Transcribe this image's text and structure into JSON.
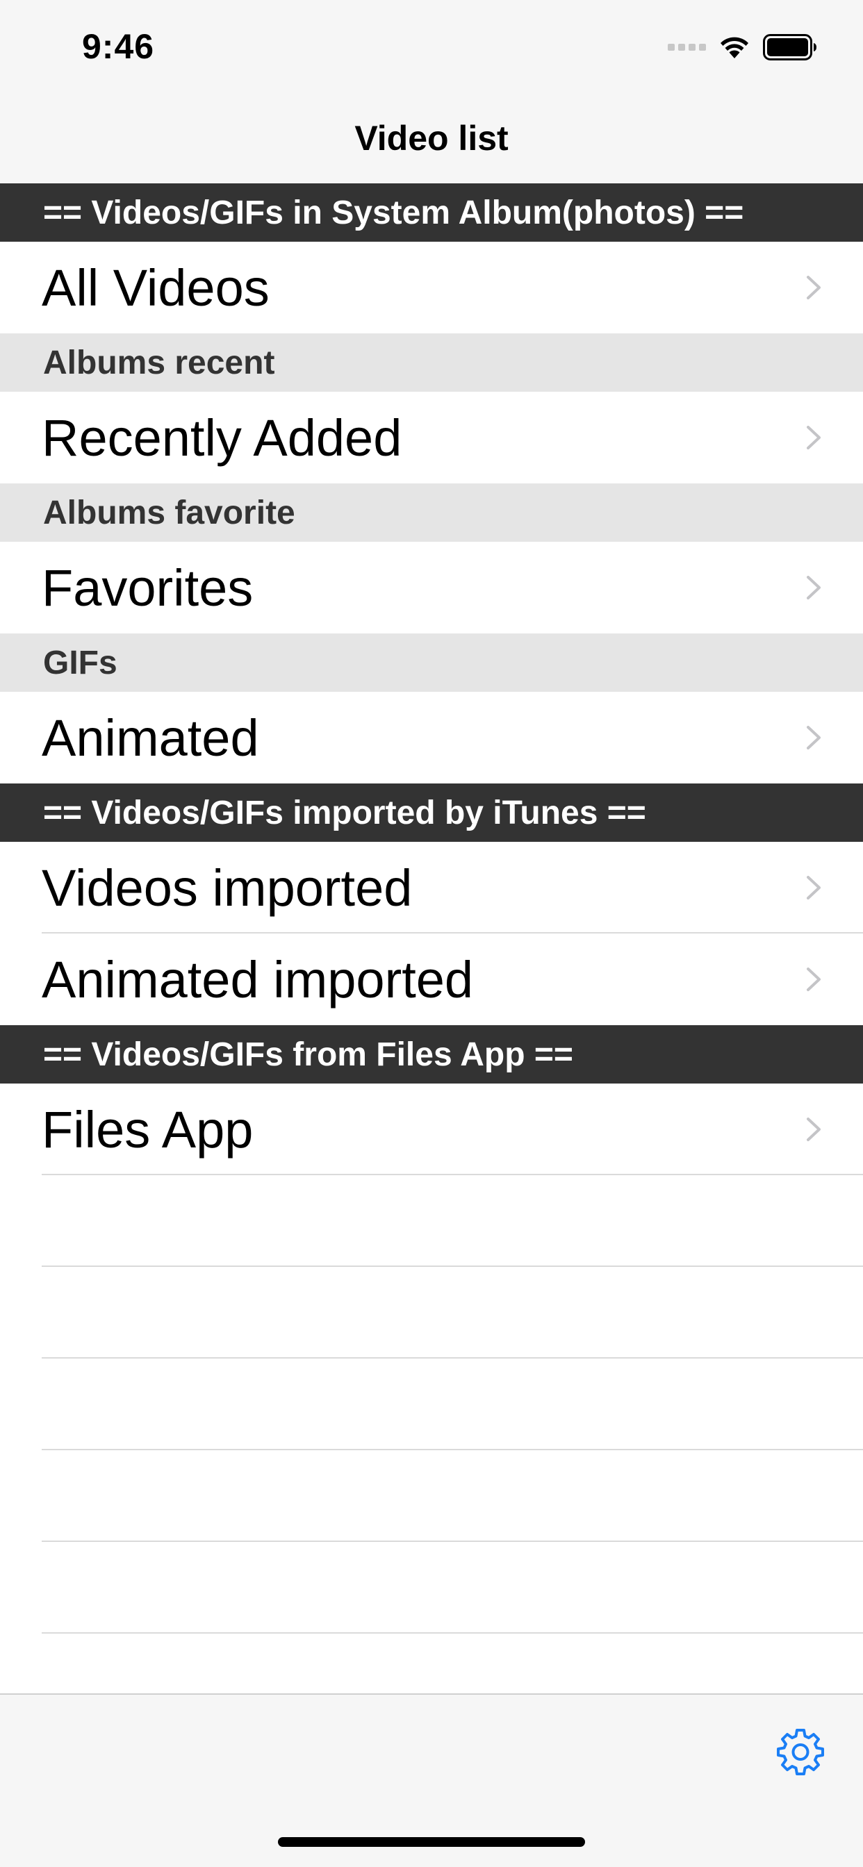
{
  "status_bar": {
    "time": "9:46"
  },
  "nav": {
    "title": "Video list"
  },
  "sections": {
    "system_album": "== Videos/GIFs in System Album(photos) ==",
    "albums_recent": "Albums recent",
    "albums_favorite": "Albums favorite",
    "gifs": "GIFs",
    "itunes": "== Videos/GIFs imported by iTunes ==",
    "files_app": "== Videos/GIFs from Files App =="
  },
  "rows": {
    "all_videos": "All Videos",
    "recently_added": "Recently Added",
    "favorites": "Favorites",
    "animated": "Animated",
    "videos_imported": "Videos imported",
    "animated_imported": "Animated imported",
    "files_app": "Files App"
  },
  "icons": {
    "chevron": "chevron-right-icon",
    "settings": "gear-icon",
    "wifi": "wifi-icon",
    "battery": "battery-icon"
  },
  "colors": {
    "dark_header": "#333333",
    "light_header": "#e5e5e5",
    "accent": "#1a7ef5",
    "chevron": "#c4c4c7"
  }
}
